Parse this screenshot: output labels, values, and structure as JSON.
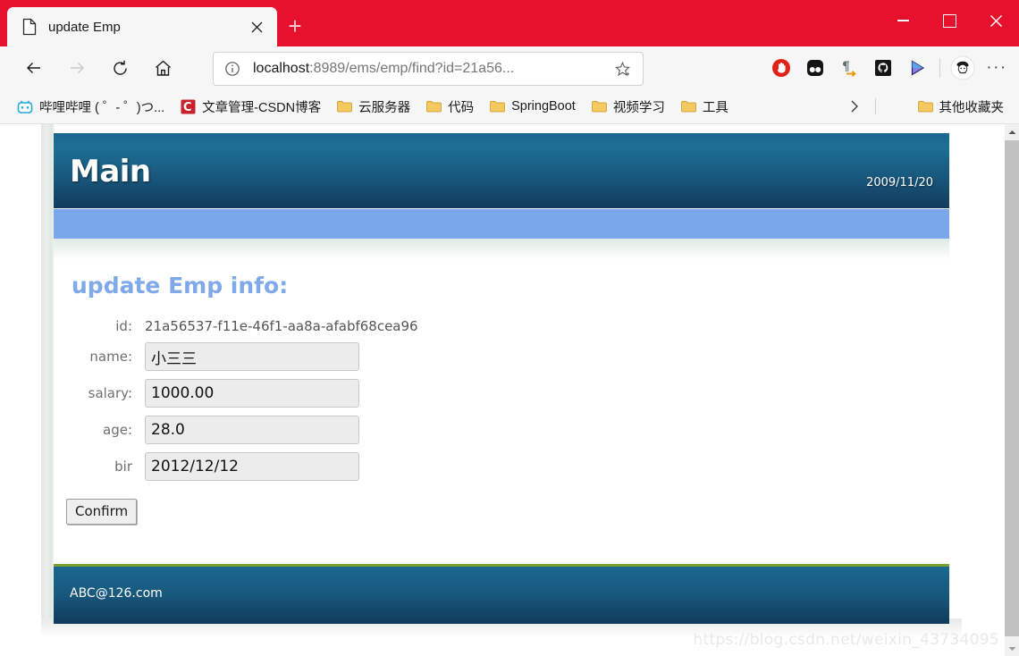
{
  "browser": {
    "tab": {
      "title": "update Emp",
      "favicon_icon": "document-icon",
      "close_icon": "close-icon"
    },
    "new_tab_label": "+",
    "window_controls": {
      "minimize": "minimize-icon",
      "maximize": "maximize-icon",
      "close": "close-icon"
    },
    "nav": {
      "back_icon": "back-arrow-icon",
      "forward_icon": "forward-arrow-icon",
      "refresh_icon": "refresh-icon",
      "home_icon": "home-icon"
    },
    "omnibox": {
      "info_icon": "info-circle-icon",
      "url_host": "localhost",
      "url_path": ":8989/ems/emp/find?id=21a56...",
      "star_icon": "favorite-star-icon"
    },
    "extensions": [
      {
        "name": "adblock-icon",
        "title": "AdBlock"
      },
      {
        "name": "dark-reader-icon",
        "title": "Dark Reader"
      },
      {
        "name": "pilcrow-translate-icon",
        "title": "Translate"
      },
      {
        "name": "github-icon",
        "title": "GitHub"
      },
      {
        "name": "cursor-triangle-icon",
        "title": "Pointer tool"
      }
    ],
    "profile_icon": "avatar",
    "menu_icon": "more-dots-icon",
    "bookmarks": [
      {
        "label": "哔哩哔哩 ( ゜- ゜)つ...",
        "icon": "bilibili-icon"
      },
      {
        "label": "文章管理-CSDN博客",
        "icon": "csdn-icon"
      },
      {
        "label": "云服务器",
        "icon": "folder-icon"
      },
      {
        "label": "代码",
        "icon": "folder-icon"
      },
      {
        "label": "SpringBoot",
        "icon": "folder-icon"
      },
      {
        "label": "视频学习",
        "icon": "folder-icon"
      },
      {
        "label": "工具",
        "icon": "folder-icon"
      }
    ],
    "bookmarks_overflow_icon": "chevron-right-icon",
    "other_bookmarks": {
      "label": "其他收藏夹",
      "icon": "folder-icon"
    }
  },
  "page": {
    "header": {
      "title": "Main",
      "date": "2009/11/20"
    },
    "form": {
      "heading": "update Emp info:",
      "fields": [
        {
          "label": "id:",
          "value": "21a56537-f11e-46f1-aa8a-afabf68cea96",
          "type": "static"
        },
        {
          "label": "name:",
          "value": "小三三",
          "type": "input"
        },
        {
          "label": "salary:",
          "value": "1000.00",
          "type": "input"
        },
        {
          "label": "age:",
          "value": "28.0",
          "type": "input"
        },
        {
          "label": "bir",
          "value": "2012/12/12",
          "type": "input"
        }
      ],
      "submit_label": "Confirm"
    },
    "footer": {
      "email": "ABC@126.com"
    },
    "watermark": "https://blog.csdn.net/weixin_43734095"
  },
  "colors": {
    "browser_accent": "#e8112d",
    "header_blue": "#1b6790",
    "nav_blue": "#7aa7ec",
    "heading_blue": "#7fa9e8",
    "footer_border_green": "#7aa02f"
  },
  "scrollbar": {
    "up_icon": "scroll-up-arrow-icon",
    "down_icon": "scroll-down-arrow-icon"
  }
}
